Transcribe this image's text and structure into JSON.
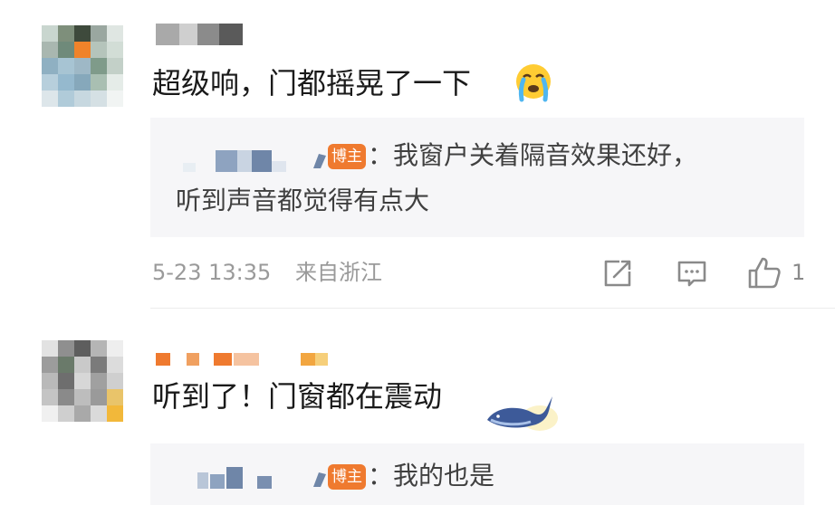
{
  "comments": [
    {
      "text": "超级响，门都摇晃了一下",
      "emoji": "crying-face-icon",
      "reply": {
        "badge": "博主",
        "line1": "：我窗户关着隔音效果还好，",
        "line2": "听到声音都觉得有点大"
      },
      "date": "5-23 13:35",
      "location": "来自浙江",
      "like_count": "1"
    },
    {
      "text": "听到了！门窗都在震动",
      "decoration": "whale-icon",
      "reply": {
        "badge": "博主",
        "line1": "：我的也是"
      }
    }
  ],
  "colors": {
    "badge": "#ef7a2f",
    "reply_bg": "#f6f6f8",
    "meta_text": "#9a9a9a"
  }
}
